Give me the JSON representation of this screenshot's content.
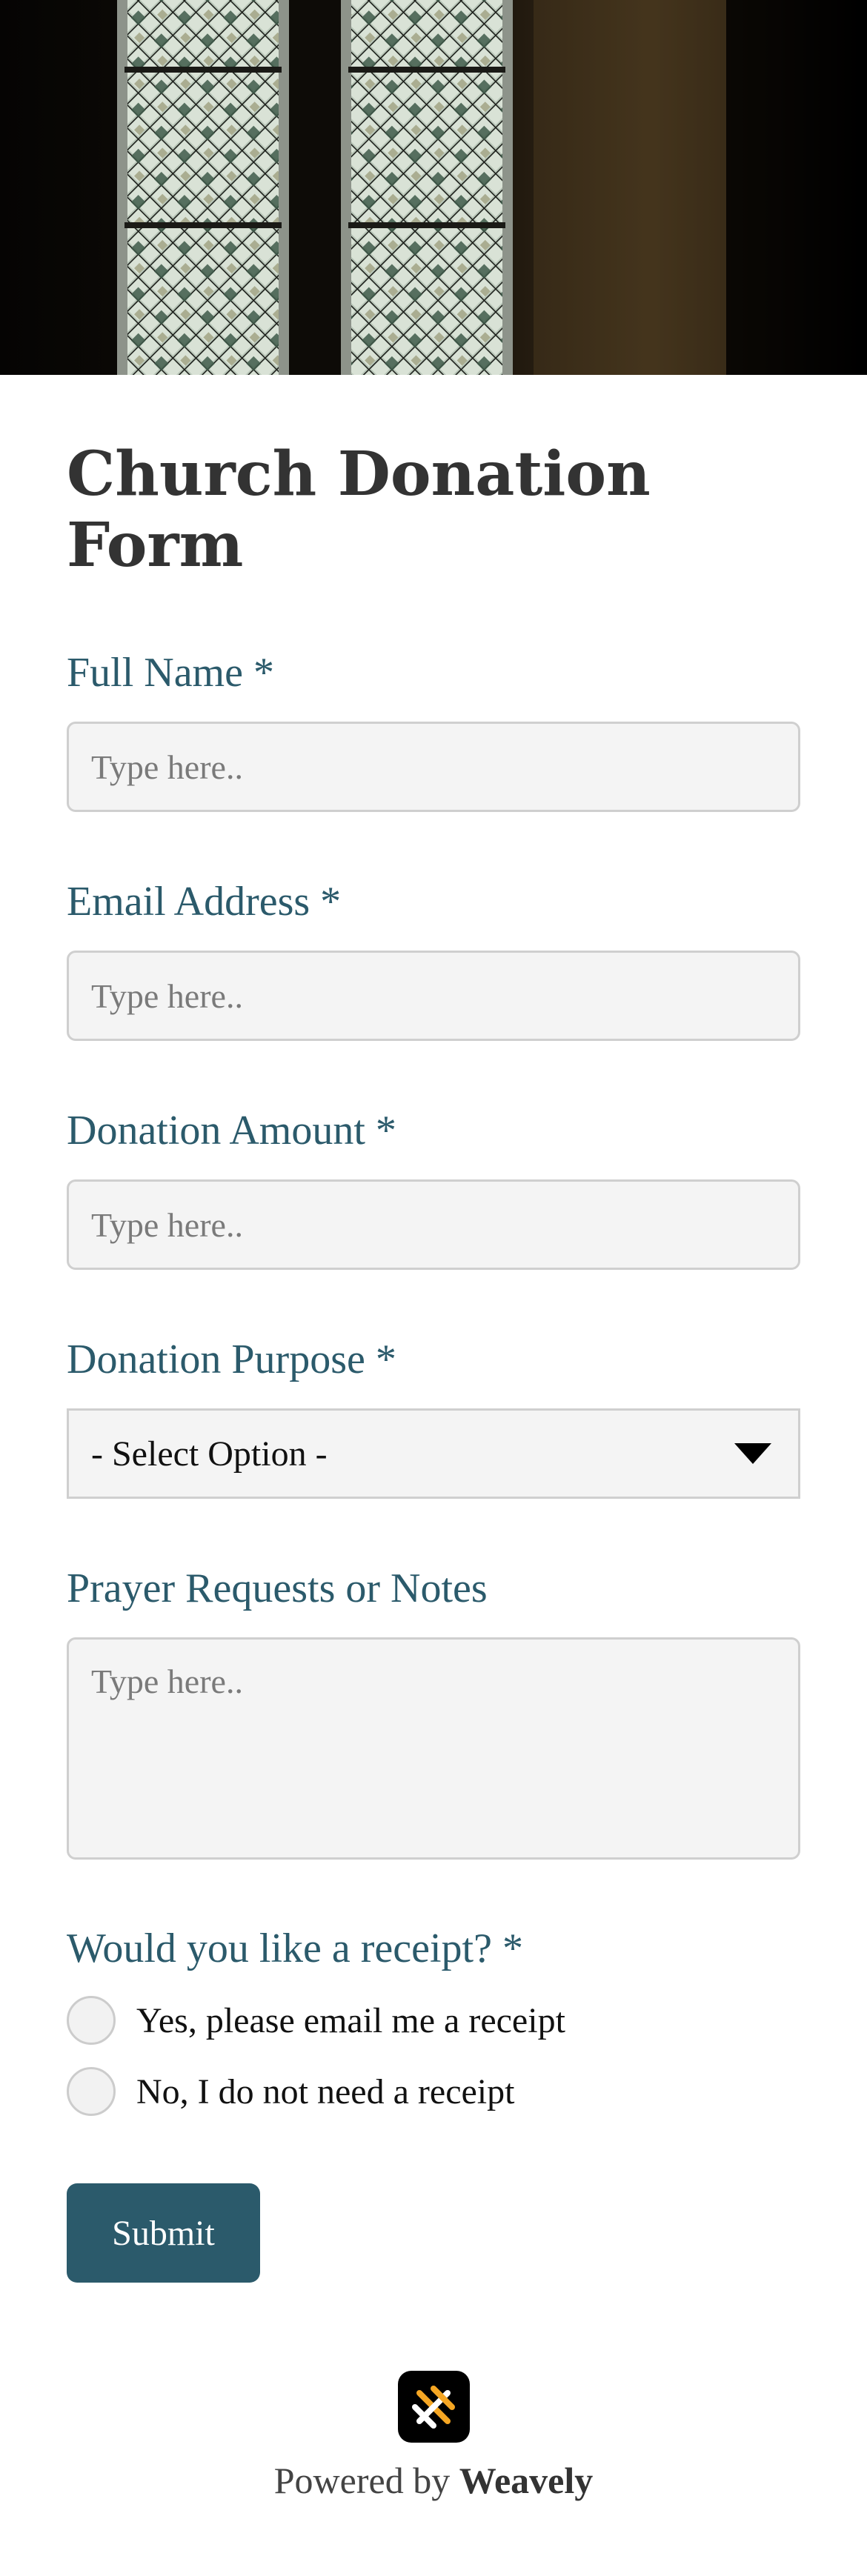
{
  "form": {
    "title": "Church Donation Form",
    "fields": {
      "full_name": {
        "label": "Full Name *",
        "placeholder": "Type here.."
      },
      "email": {
        "label": "Email Address *",
        "placeholder": "Type here.."
      },
      "amount": {
        "label": "Donation Amount *",
        "placeholder": "Type here.."
      },
      "purpose": {
        "label": "Donation Purpose *",
        "selected": "- Select Option -"
      },
      "notes": {
        "label": "Prayer Requests or Notes",
        "placeholder": "Type here.."
      },
      "receipt": {
        "label": "Would you like a receipt? *",
        "options": [
          "Yes, please email me a receipt",
          "No, I do not need a receipt"
        ]
      }
    },
    "submit_label": "Submit"
  },
  "footer": {
    "powered_prefix": "Powered by",
    "brand": "Weavely"
  },
  "colors": {
    "accent": "#2b5a6b",
    "title": "#333333",
    "input_bg": "#f4f4f4"
  }
}
